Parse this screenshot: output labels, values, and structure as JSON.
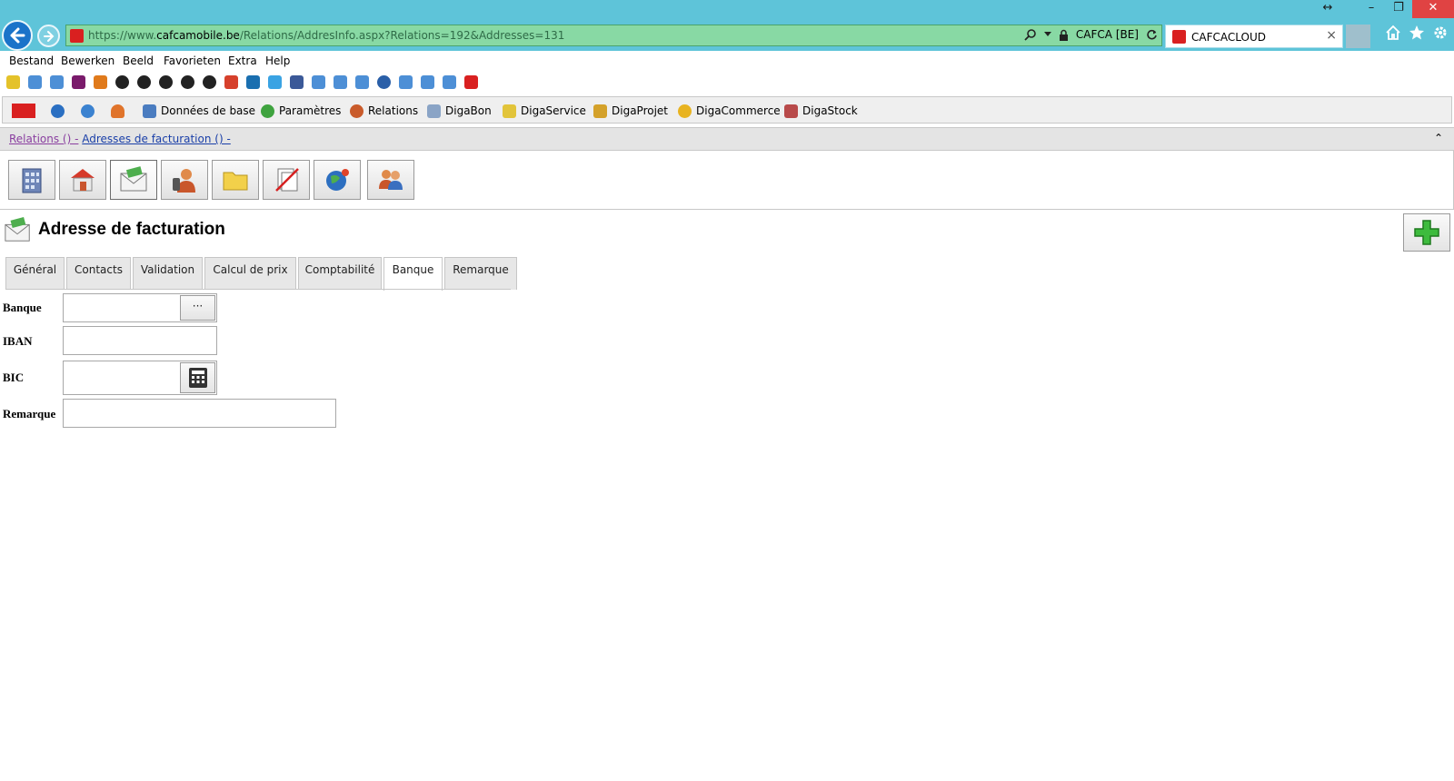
{
  "browser": {
    "url_scheme": "https://www.",
    "url_host": "cafcamobile.be",
    "url_path": "/Relations/AddresInfo.aspx?Relations=192&Addresses=131",
    "site_identity": "CAFCA [BE]",
    "tab_title": "CAFCACLOUD",
    "tab_close": "×"
  },
  "menu": [
    "Bestand",
    "Bewerken",
    "Beeld",
    "Favorieten",
    "Extra",
    "Help"
  ],
  "toolbar": {
    "items": [
      "Données de base",
      "Paramètres",
      "Relations",
      "DigaBon",
      "DigaService",
      "DigaProjet",
      "DigaCommerce",
      "DigaStock"
    ]
  },
  "breadcrumb": {
    "relations": "Relations () -",
    "adresses": "Adresses de facturation () -",
    "collapse": "⌃"
  },
  "page": {
    "title": "Adresse de facturation"
  },
  "tabs": [
    "Général",
    "Contacts",
    "Validation",
    "Calcul de prix",
    "Comptabilité",
    "Banque",
    "Remarque"
  ],
  "active_tab": "Banque",
  "form": {
    "banque_label": "Banque",
    "banque_value": "",
    "banque_lookup": "···",
    "iban_label": "IBAN",
    "iban_value": "",
    "bic_label": "BIC",
    "bic_value": "",
    "remarque_label": "Remarque",
    "remarque_value": ""
  },
  "colors": {
    "chrome": "#5ec4d9",
    "address_bar": "#88d9a4",
    "accent_green": "#2f9e2f"
  }
}
